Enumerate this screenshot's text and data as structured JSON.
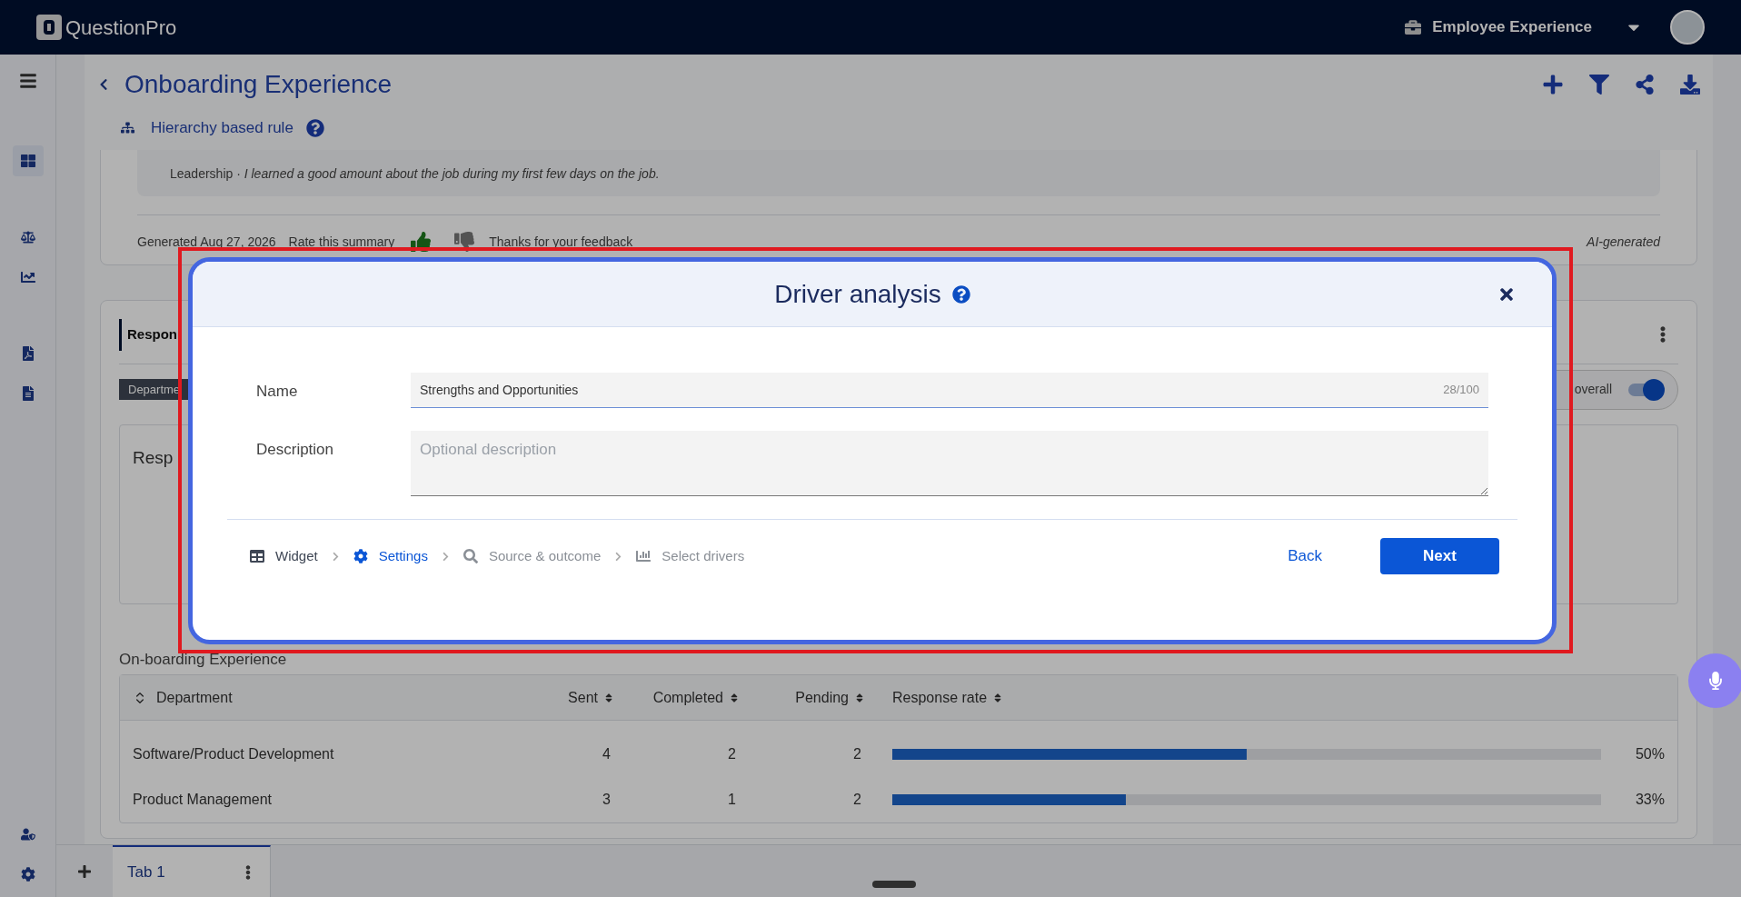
{
  "topbar": {
    "brand": "QuestionPro",
    "product": "Employee Experience"
  },
  "sidebar": {
    "items": [
      {
        "kind": "menu",
        "selected": false
      },
      {
        "kind": "dashboard",
        "selected": true
      },
      {
        "kind": "compare",
        "selected": false
      },
      {
        "kind": "trend",
        "selected": false
      },
      {
        "kind": "pdf",
        "selected": false
      },
      {
        "kind": "document",
        "selected": false
      }
    ],
    "bottom_items": [
      {
        "kind": "admin",
        "selected": false
      },
      {
        "kind": "settings",
        "selected": false
      }
    ]
  },
  "header": {
    "title": "Onboarding Experience",
    "rule": "Hierarchy based rule"
  },
  "summary": {
    "quote_source": "Leadership ·",
    "quote": "I learned a good amount about the job during my first few days on the job.",
    "generated": "Generated Aug 27, 2026",
    "rate_label": "Rate this summary",
    "thumbs_up_selected": true,
    "thumbs_down_selected": false,
    "feedback": "Thanks for your feedback",
    "ai_label": "AI-generated"
  },
  "responses": {
    "title": "Respon",
    "chip": "Departme",
    "toggle_label": "overall",
    "toggle_on": true,
    "inner_title": "Resp",
    "table_title": "On-boarding Experience",
    "table": {
      "columns": [
        "Department",
        "Sent",
        "Completed",
        "Pending",
        "Response rate"
      ],
      "rows": [
        {
          "department": "Software/Product Development",
          "sent": "4",
          "completed": "2",
          "pending": "2",
          "level": 0.5,
          "rate": "50%"
        },
        {
          "department": "Product Management",
          "sent": "3",
          "completed": "1",
          "pending": "2",
          "level": 0.33,
          "rate": "33%"
        }
      ]
    }
  },
  "modal": {
    "title": "Driver analysis",
    "name_label": "Name",
    "name_value": "Strengths and Opportunities",
    "name_counter": "28/100",
    "description_label": "Description",
    "description_placeholder": "Optional description",
    "steps": [
      {
        "kind": "widget",
        "label": "Widget",
        "selected": false,
        "disabled": false
      },
      {
        "kind": "settings",
        "label": "Settings",
        "selected": true,
        "disabled": false
      },
      {
        "kind": "source",
        "label": "Source & outcome",
        "selected": false,
        "disabled": true
      },
      {
        "kind": "drivers",
        "label": "Select drivers",
        "selected": false,
        "disabled": true
      }
    ],
    "back": "Back",
    "next": "Next"
  },
  "tabs": [
    {
      "label": "Tab 1",
      "selected": true
    }
  ]
}
